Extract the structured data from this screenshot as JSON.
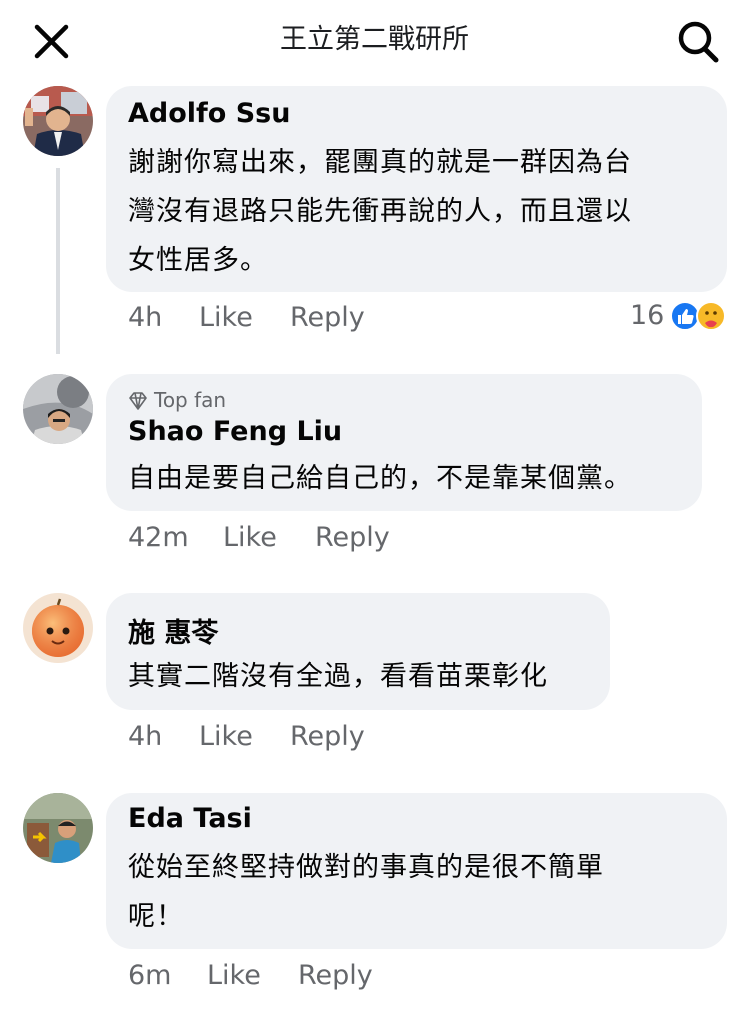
{
  "header": {
    "title": "王立第二戰研所",
    "close_icon": "close-icon",
    "search_icon": "search-icon"
  },
  "comments": [
    {
      "author": "Adolfo Ssu",
      "lines": [
        "謝謝你寫出來，罷團真的就是一群因為台",
        "灣沒有退路只能先衝再說的人，而且還以",
        "女性居多。"
      ],
      "time": "4h",
      "like": "Like",
      "reply": "Reply",
      "reaction_count": "16",
      "reaction_icons": [
        "like-reaction-icon",
        "care-reaction-icon"
      ]
    },
    {
      "badge": "Top fan",
      "badge_icon": "diamond-icon",
      "author": "Shao Feng Liu",
      "lines": [
        "自由是要自己給自己的，不是靠某個黨。"
      ],
      "time": "42m",
      "like": "Like",
      "reply": "Reply"
    },
    {
      "author": "施 惠苓",
      "lines": [
        "其實二階沒有全過，看看苗栗彰化"
      ],
      "time": "4h",
      "like": "Like",
      "reply": "Reply"
    },
    {
      "author": "Eda Tasi",
      "lines": [
        "從始至終堅持做對的事真的是很不簡單",
        "呢！"
      ],
      "time": "6m",
      "like": "Like",
      "reply": "Reply"
    }
  ],
  "colors": {
    "bubble": "#f0f2f5",
    "secondary_text": "#65676b",
    "like_blue": "#1877f2",
    "care_yellow": "#f7b928"
  }
}
